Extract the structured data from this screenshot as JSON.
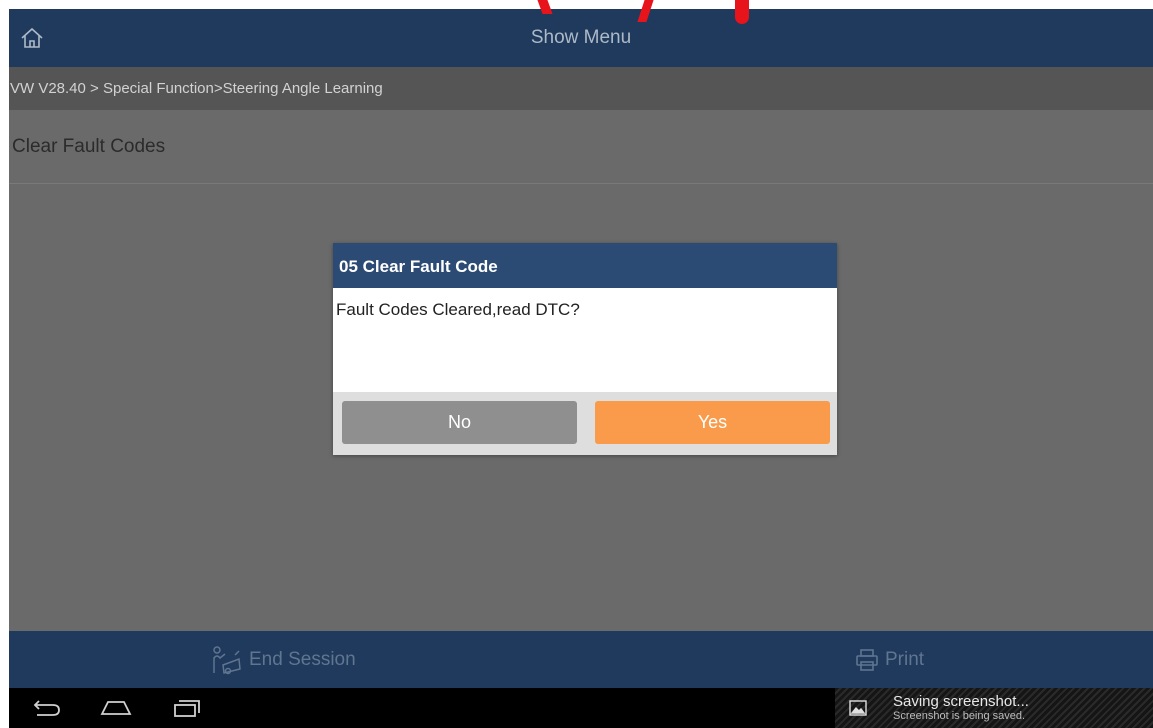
{
  "header": {
    "title": "Show Menu",
    "home_icon": "home-icon"
  },
  "breadcrumb": "VW V28.40 > Special Function>Steering Angle Learning",
  "content": {
    "items": [
      {
        "label": "Clear Fault Codes"
      }
    ]
  },
  "dialog": {
    "title": "05 Clear Fault Code",
    "message": "Fault Codes Cleared,read DTC?",
    "no_label": "No",
    "yes_label": "Yes"
  },
  "footer": {
    "end_session_label": "End Session",
    "print_label": "Print"
  },
  "toast": {
    "title": "Saving screenshot...",
    "subtitle": "Screenshot is being saved."
  },
  "colors": {
    "header_bg": "#1f3a5c",
    "dialog_header": "#2c4b74",
    "yes_button": "#f99b4b",
    "no_button": "#8f8f8f"
  }
}
